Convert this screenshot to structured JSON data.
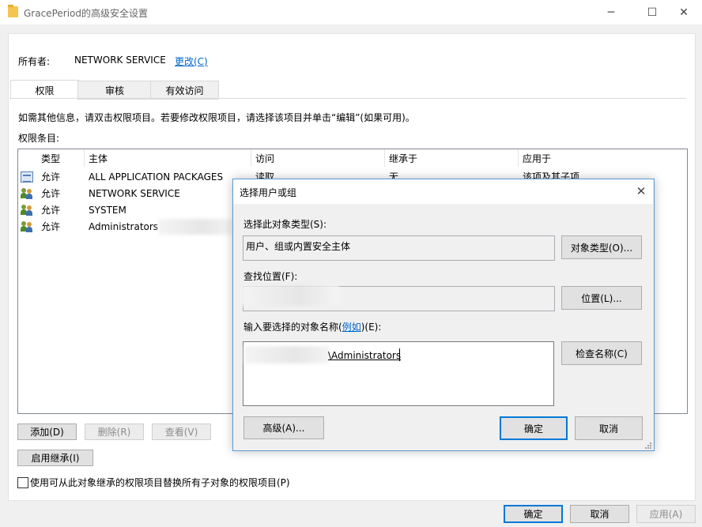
{
  "window": {
    "title": "GracePeriod的高级安全设置",
    "minimize": "─",
    "maximize": "☐",
    "close": "✕"
  },
  "owner": {
    "label": "所有者:",
    "value": "NETWORK SERVICE",
    "change_link": "更改(C)"
  },
  "tabs": [
    {
      "label": "权限",
      "active": true
    },
    {
      "label": "审核",
      "active": false
    },
    {
      "label": "有效访问",
      "active": false
    }
  ],
  "info_text": "如需其他信息，请双击权限项目。若要修改权限项目，请选择该项目并单击“编辑”(如果可用)。",
  "entries_label": "权限条目:",
  "table": {
    "columns": [
      "类型",
      "主体",
      "访问",
      "继承于",
      "应用于"
    ],
    "rows": [
      {
        "icon": "package-icon",
        "type": "允许",
        "principal": "ALL APPLICATION PACKAGES",
        "access": "读取",
        "inherited": "无",
        "applies": "该项及其子项"
      },
      {
        "icon": "users-icon",
        "type": "允许",
        "principal": "NETWORK SERVICE",
        "access": "",
        "inherited": "",
        "applies": ""
      },
      {
        "icon": "users-icon",
        "type": "允许",
        "principal": "SYSTEM",
        "access": "",
        "inherited": "",
        "applies": ""
      },
      {
        "icon": "users-icon",
        "type": "允许",
        "principal": "Administrators",
        "access": "",
        "inherited": "",
        "applies": ""
      }
    ]
  },
  "buttons": {
    "add": "添加(D)",
    "remove": "删除(R)",
    "view": "查看(V)",
    "enable_inheritance": "启用继承(I)",
    "ok": "确定",
    "cancel": "取消",
    "apply": "应用(A)"
  },
  "replace_checkbox_label": "使用可从此对象继承的权限项目替换所有子对象的权限项目(P)",
  "dialog": {
    "title": "选择用户或组",
    "close": "✕",
    "object_type_label": "选择此对象类型(S):",
    "object_type_value": "用户、组或内置安全主体",
    "object_type_button": "对象类型(O)...",
    "location_label": "查找位置(F):",
    "location_button": "位置(L)...",
    "names_label_prefix": "输入要选择的对象名称(",
    "names_label_link": "例如",
    "names_label_suffix": ")(E):",
    "names_value": "\\Administrators",
    "check_names_button": "检查名称(C)",
    "advanced_button": "高级(A)...",
    "ok_button": "确定",
    "cancel_button": "取消"
  }
}
